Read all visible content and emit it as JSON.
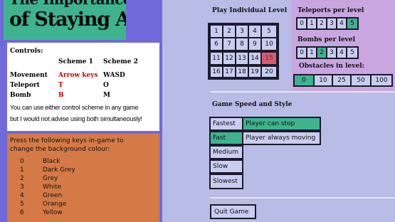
{
  "title": {
    "line1": "The Importance",
    "line2": "of Staying Alive"
  },
  "controls": {
    "heading": "Controls:",
    "scheme1": "Scheme 1",
    "scheme2": "Scheme 2",
    "rows": [
      {
        "label": "Movement",
        "s1": "Arrow keys",
        "s2": "WASD"
      },
      {
        "label": "Teleport",
        "s1": "T",
        "s2": "O"
      },
      {
        "label": "Bomb",
        "s1": "B",
        "s2": "M"
      }
    ],
    "note1": "You can use either control scheme in any game",
    "note2": "but I would not advise using both simultaneously!"
  },
  "background_colour": {
    "heading1": "Press the following keys in-game to",
    "heading2": "change the background colour:",
    "options": [
      {
        "key": "0",
        "name": "Black"
      },
      {
        "key": "1",
        "name": "Dark Grey"
      },
      {
        "key": "2",
        "name": "Grey"
      },
      {
        "key": "3",
        "name": "White"
      },
      {
        "key": "4",
        "name": "Green"
      },
      {
        "key": "5",
        "name": "Orange"
      },
      {
        "key": "6",
        "name": "Yellow"
      }
    ]
  },
  "levels": {
    "heading": "Play Individual Level",
    "items": [
      "1",
      "2",
      "3",
      "4",
      "5",
      "6",
      "7",
      "8",
      "9",
      "10",
      "11",
      "12",
      "13",
      "14",
      "15",
      "16",
      "17",
      "18",
      "19",
      "20"
    ],
    "highlighted": "15"
  },
  "teleports": {
    "heading": "Teleports per level",
    "options": [
      "0",
      "1",
      "2",
      "3",
      "4",
      "5"
    ],
    "selected": "5"
  },
  "bombs": {
    "heading": "Bombs per level",
    "options": [
      "0",
      "1",
      "2",
      "3",
      "4",
      "5"
    ],
    "selected": "2"
  },
  "obstacles": {
    "heading": "Obstacles in level:",
    "options": [
      "0",
      "10",
      "25",
      "50",
      "100"
    ],
    "selected": "0"
  },
  "game_speed": {
    "heading": "Game Speed and Style",
    "speeds": [
      "Fastest",
      "Fast",
      "Medium",
      "Slow",
      "Slowest"
    ],
    "selected_speed": "Fast",
    "styles": [
      "Player can stop",
      "Player always moving"
    ],
    "selected_style": "Player can stop"
  },
  "quit_label": "Quit Game",
  "colors": {
    "green": "#3fb38e",
    "purple": "#c9a6e0",
    "orange": "#d57a47",
    "left_bg": "#6f69d9",
    "right_bg": "#b9bce6",
    "red": "#c40000"
  }
}
